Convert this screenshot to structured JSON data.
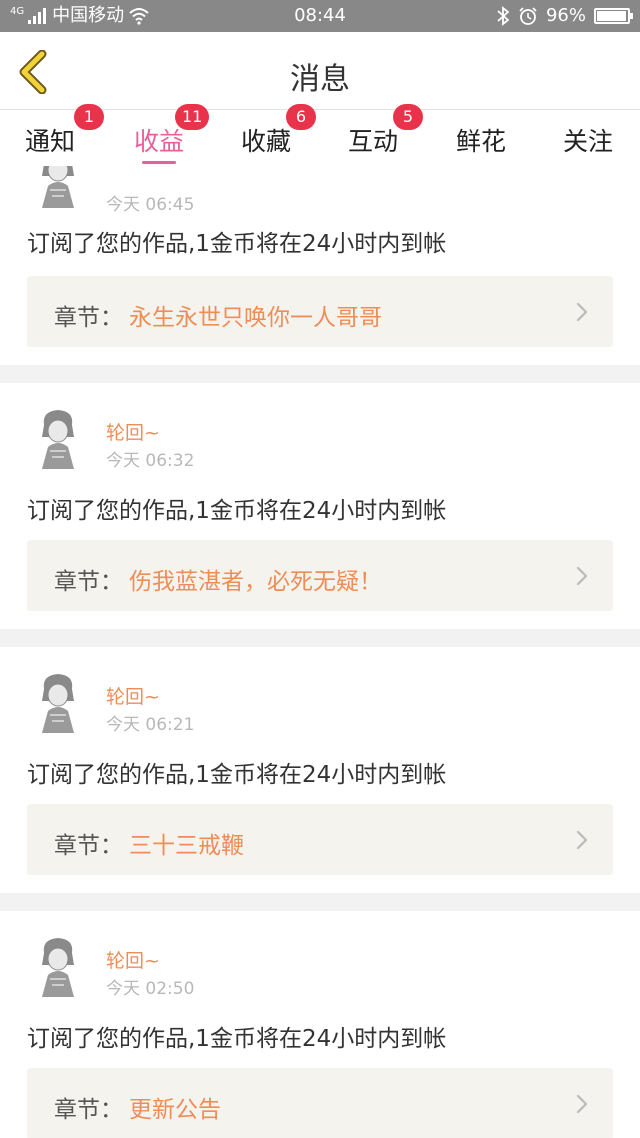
{
  "status_bar": {
    "network": "4G",
    "carrier": "中国移动",
    "time": "08:44",
    "battery": "96%",
    "battery_level": 0.96
  },
  "header": {
    "title": "消息"
  },
  "tabs": [
    {
      "label": "通知",
      "badge": "1"
    },
    {
      "label": "收益",
      "badge": "11",
      "active": true
    },
    {
      "label": "收藏",
      "badge": "6"
    },
    {
      "label": "互动",
      "badge": "5"
    },
    {
      "label": "鲜花",
      "badge": ""
    },
    {
      "label": "关注",
      "badge": ""
    }
  ],
  "colors": {
    "accent": "#e8609b",
    "badge": "#e8334a",
    "username": "#ef8d57",
    "chapter_bg": "#f4f3ee"
  },
  "items": [
    {
      "username": "",
      "time": "今天 06:45",
      "message": "订阅了您的作品,1金币将在24小时内到帐",
      "chapter_label": "章节：",
      "chapter_title": "永生永世只唤你一人哥哥"
    },
    {
      "username": "轮回~",
      "time": "今天 06:32",
      "message": "订阅了您的作品,1金币将在24小时内到帐",
      "chapter_label": "章节：",
      "chapter_title": "伤我蓝湛者，必死无疑！"
    },
    {
      "username": "轮回~",
      "time": "今天 06:21",
      "message": "订阅了您的作品,1金币将在24小时内到帐",
      "chapter_label": "章节：",
      "chapter_title": "三十三戒鞭"
    },
    {
      "username": "轮回~",
      "time": "今天 02:50",
      "message": "订阅了您的作品,1金币将在24小时内到帐",
      "chapter_label": "章节：",
      "chapter_title": "更新公告"
    }
  ]
}
